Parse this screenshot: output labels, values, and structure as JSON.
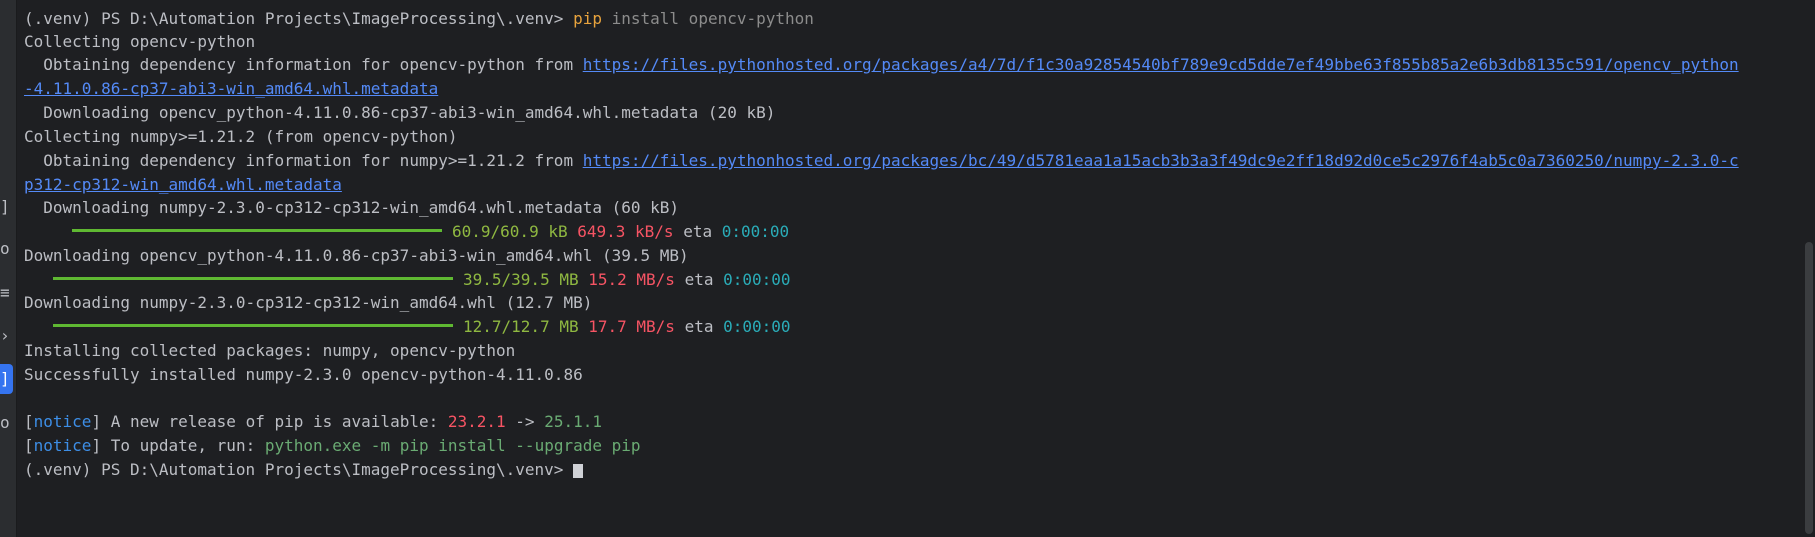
{
  "terminal": {
    "prompt_line": {
      "prompt": "(.venv) PS D:\\Automation Projects\\ImageProcessing\\.venv> ",
      "command": "pip",
      "args": " install opencv-python"
    },
    "collecting_opencv": "Collecting opencv-python",
    "obtaining_opencv": {
      "text": "  Obtaining dependency information for opencv-python from ",
      "link_part1": "https://files.pythonhosted.org/packages/a4/7d/f1c30a92854540bf789e9cd5dde7ef49bbe63f855b85a2e6b3db8135c591/opencv_python",
      "link_part2": "-4.11.0.86-cp37-abi3-win_amd64.whl.metadata"
    },
    "downloading_opencv_meta": "  Downloading opencv_python-4.11.0.86-cp37-abi3-win_amd64.whl.metadata (20 kB)",
    "collecting_numpy": "Collecting numpy>=1.21.2 (from opencv-python)",
    "obtaining_numpy": {
      "text": "  Obtaining dependency information for numpy>=1.21.2 from ",
      "link_part1": "https://files.pythonhosted.org/packages/bc/49/d5781eaa1a15acb3b3a3f49dc9e2ff18d92d0ce5c2976f4ab5c0a7360250/numpy-2.3.0-c",
      "link_part2": "p312-cp312-win_amd64.whl.metadata"
    },
    "downloading_numpy_meta": "  Downloading numpy-2.3.0-cp312-cp312-win_amd64.whl.metadata (60 kB)",
    "progress_1": {
      "size": "60.9/60.9 kB",
      "speed": "649.3 kB/s",
      "eta_label": "eta",
      "eta": "0:00:00",
      "fraction": 1.0
    },
    "downloading_opencv_whl": "Downloading opencv_python-4.11.0.86-cp37-abi3-win_amd64.whl (39.5 MB)",
    "progress_2": {
      "size": "39.5/39.5 MB",
      "speed": "15.2 MB/s",
      "eta_label": "eta",
      "eta": "0:00:00",
      "fraction": 1.0
    },
    "downloading_numpy_whl": "Downloading numpy-2.3.0-cp312-cp312-win_amd64.whl (12.7 MB)",
    "progress_3": {
      "size": "12.7/12.7 MB",
      "speed": "17.7 MB/s",
      "eta_label": "eta",
      "eta": "0:00:00",
      "fraction": 1.0
    },
    "installing": "Installing collected packages: numpy, opencv-python",
    "success": "Successfully installed numpy-2.3.0 opencv-python-4.11.0.86",
    "notice_1": {
      "bracket_open": "[",
      "tag": "notice",
      "bracket_close": "]",
      "text": " A new release of pip is available: ",
      "old_version": "23.2.1",
      "arrow": " -> ",
      "new_version": "25.1.1"
    },
    "notice_2": {
      "bracket_open": "[",
      "tag": "notice",
      "bracket_close": "]",
      "text": " To update, run: ",
      "command": "python.exe -m pip install --upgrade pip"
    },
    "last_prompt": "(.venv) PS D:\\Automation Projects\\ImageProcessing\\.venv> "
  },
  "sidebar_icons": [
    {
      "name": "bracket-icon",
      "glyph": "]"
    },
    {
      "name": "circle-icon",
      "glyph": "o"
    },
    {
      "name": "stack-icon",
      "glyph": "≡"
    },
    {
      "name": "chevron-icon",
      "glyph": "›"
    },
    {
      "name": "terminal-icon",
      "glyph": "]"
    },
    {
      "name": "dot-icon",
      "glyph": "o"
    }
  ],
  "colors": {
    "background": "#1e1f22",
    "text": "#bcbec4",
    "link": "#548af7",
    "command": "#e8a33d",
    "progress_bar": "#5fb832",
    "speed": "#f75464",
    "eta": "#2aacb8",
    "notice": "#3d8ee6"
  }
}
